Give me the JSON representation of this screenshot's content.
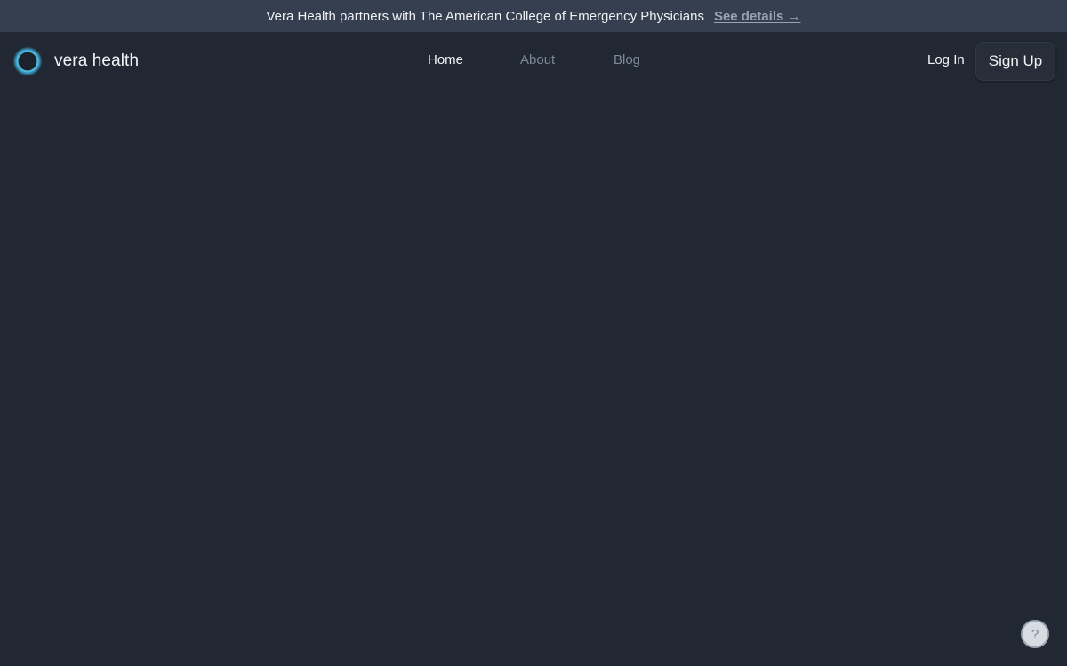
{
  "announcement": {
    "text": "Vera Health partners with The American College of Emergency Physicians",
    "link_label": "See details →"
  },
  "brand": {
    "name": "vera health",
    "logo_icon": "ring-logo-icon"
  },
  "nav": {
    "items": [
      {
        "label": "Home",
        "active": true
      },
      {
        "label": "About",
        "active": false
      },
      {
        "label": "Blog",
        "active": false
      }
    ]
  },
  "auth": {
    "login_label": "Log In",
    "signup_label": "Sign Up"
  },
  "help": {
    "label": "?",
    "icon": "question-icon"
  },
  "colors": {
    "background": "#222833",
    "announcement_bar": "#353f4f",
    "text_primary": "#f2f4f7",
    "text_muted": "#7f8896",
    "logo_accent": "#3aa6cf"
  }
}
